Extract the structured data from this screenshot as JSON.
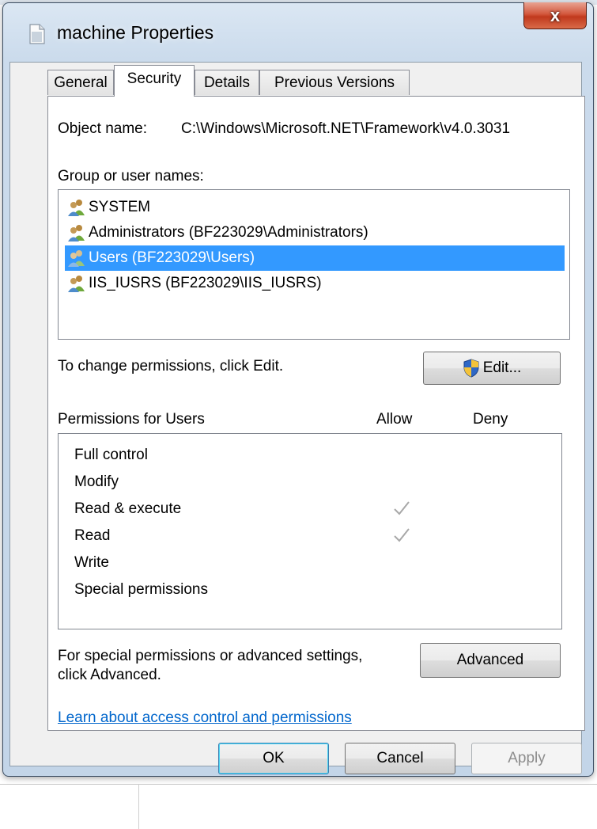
{
  "window": {
    "title": "machine Properties",
    "close_label": "x"
  },
  "tabs": [
    {
      "label": "General"
    },
    {
      "label": "Security"
    },
    {
      "label": "Details"
    },
    {
      "label": "Previous Versions"
    }
  ],
  "security": {
    "object_name_label": "Object name:",
    "object_name_value": "C:\\Windows\\Microsoft.NET\\Framework\\v4.0.3031",
    "group_label": "Group or user names:",
    "users": [
      {
        "name": "SYSTEM",
        "selected": false
      },
      {
        "name": "Administrators (BF223029\\Administrators)",
        "selected": false
      },
      {
        "name": "Users (BF223029\\Users)",
        "selected": true
      },
      {
        "name": "IIS_IUSRS (BF223029\\IIS_IUSRS)",
        "selected": false
      }
    ],
    "change_hint": "To change permissions, click Edit.",
    "edit_label": "Edit...",
    "permissions_header": "Permissions for Users",
    "allow_header": "Allow",
    "deny_header": "Deny",
    "permissions": [
      {
        "name": "Full control",
        "allow": false,
        "deny": false
      },
      {
        "name": "Modify",
        "allow": false,
        "deny": false
      },
      {
        "name": "Read & execute",
        "allow": true,
        "deny": false
      },
      {
        "name": "Read",
        "allow": true,
        "deny": false
      },
      {
        "name": "Write",
        "allow": false,
        "deny": false
      },
      {
        "name": "Special permissions",
        "allow": false,
        "deny": false
      }
    ],
    "advanced_hint_line1": "For special permissions or advanced settings,",
    "advanced_hint_line2": "click Advanced.",
    "advanced_label": "Advanced",
    "learn_link": "Learn about access control and permissions"
  },
  "footer": {
    "ok_label": "OK",
    "cancel_label": "Cancel",
    "apply_label": "Apply"
  },
  "colors": {
    "selection": "#3399ff",
    "link": "#0066cc",
    "close_button": "#c0391d"
  }
}
